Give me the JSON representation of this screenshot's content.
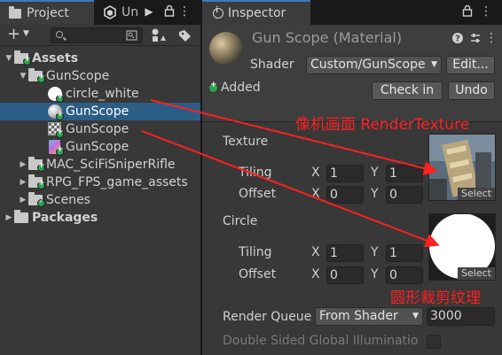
{
  "project_panel": {
    "tab_project": "Project",
    "tab_second": "Un",
    "search": {
      "value": "",
      "placeholder": ""
    },
    "tree": [
      {
        "label": "Assets"
      },
      {
        "label": "GunScope"
      },
      {
        "label": "circle_white"
      },
      {
        "label": "GunScope"
      },
      {
        "label": "GunScope"
      },
      {
        "label": "GunScope"
      },
      {
        "label": "MAC_SciFiSniperRifle"
      },
      {
        "label": "RPG_FPS_game_assets"
      },
      {
        "label": "Scenes"
      },
      {
        "label": "Packages"
      }
    ]
  },
  "inspector": {
    "tab_label": "Inspector",
    "title": "Gun Scope (Material)",
    "shader_label": "Shader",
    "shader_value": "Custom/GunScope",
    "edit_button": "Edit...",
    "status": "Added",
    "checkin_button": "Check in",
    "undo_button": "Undo",
    "texture_section": {
      "title": "Texture",
      "tiling_label": "Tiling",
      "offset_label": "Offset",
      "tiling_x": "1",
      "tiling_y": "1",
      "offset_x": "0",
      "offset_y": "0",
      "select_label": "Select"
    },
    "circle_section": {
      "title": "Circle",
      "tiling_label": "Tiling",
      "offset_label": "Offset",
      "tiling_x": "1",
      "tiling_y": "1",
      "offset_x": "0",
      "offset_y": "0",
      "select_label": "Select"
    },
    "render_queue_label": "Render Queue",
    "render_queue_mode": "From Shader",
    "render_queue_value": "3000",
    "double_sided_label": "Double Sided Global Illuminatio",
    "axis_x": "X",
    "axis_y": "Y"
  },
  "annotations": {
    "render_texture": "像机画面 RenderTexture",
    "circle_clip": "圆形裁剪纹理"
  },
  "colors": {
    "selection": "#2c5d87",
    "accent_tab": "#3a79bb",
    "added_badge": "#2ea44f",
    "annotation": "#ff2020"
  }
}
